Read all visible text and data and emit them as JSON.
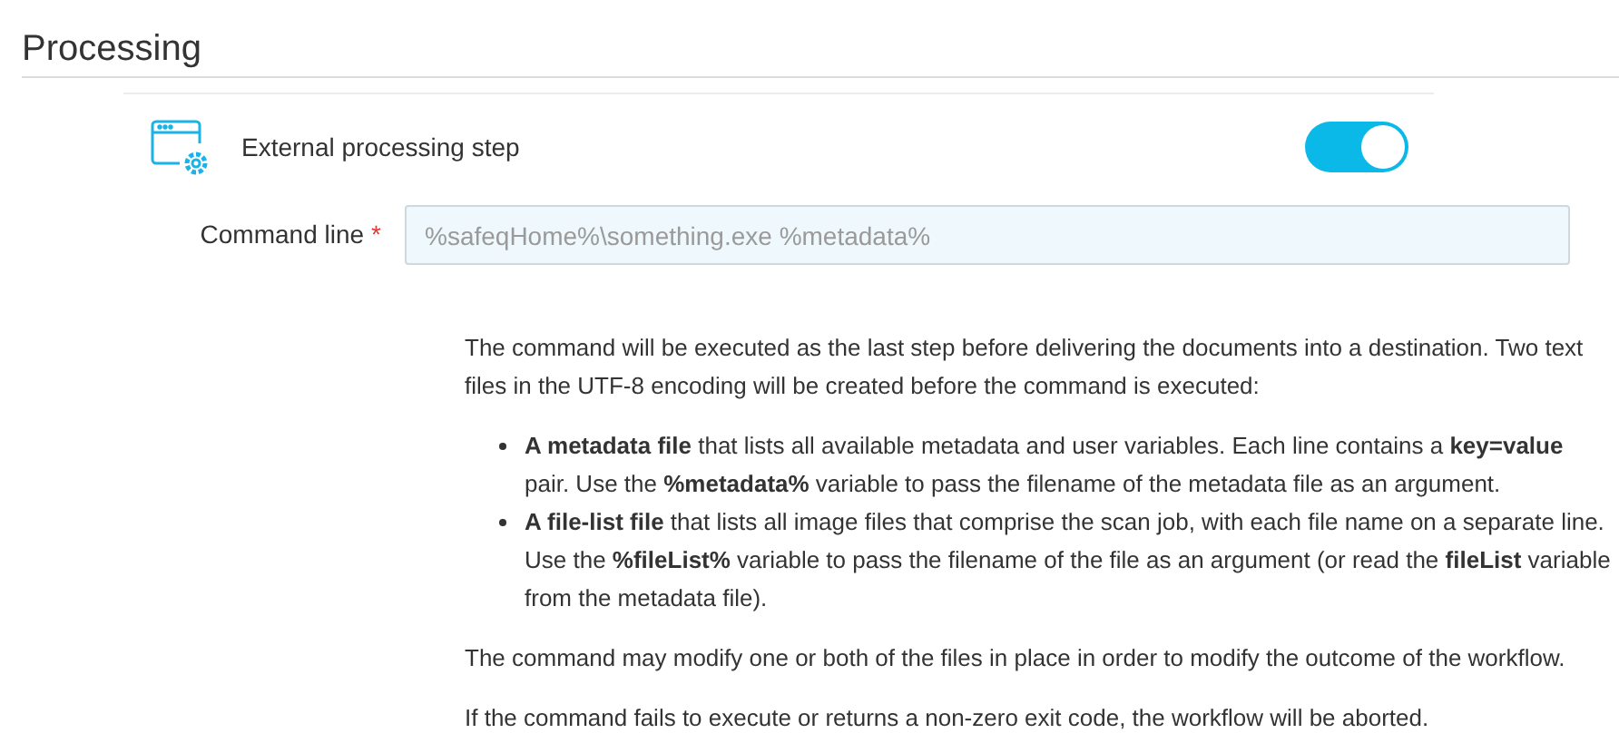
{
  "section_title": "Processing",
  "step": {
    "label": "External processing step",
    "on": true
  },
  "command_field": {
    "label": "Command line",
    "required_mark": "*",
    "placeholder": "%safeqHome%\\something.exe %metadata%"
  },
  "description": {
    "intro": "The command will be executed as the last step before delivering the documents into a destination. Two text files in the UTF-8 encoding will be created before the command is executed:",
    "bullets": [
      "**A metadata file** that lists all available metadata and user variables. Each line contains a **key=value** pair. Use the **%metadata%** variable to pass the filename of the metadata file as an argument.",
      "**A file-list file** that lists all image files that comprise the scan job, with each file name on a separate line. Use the **%fileList%** variable to pass the filename of the file as an argument (or read the **fileList** variable from the metadata file)."
    ],
    "paragraphs": [
      "The command may modify one or both of the files in place in order to modify the outcome of the workflow.",
      "If the command fails to execute or returns a non-zero exit code, the workflow will be aborted."
    ]
  }
}
